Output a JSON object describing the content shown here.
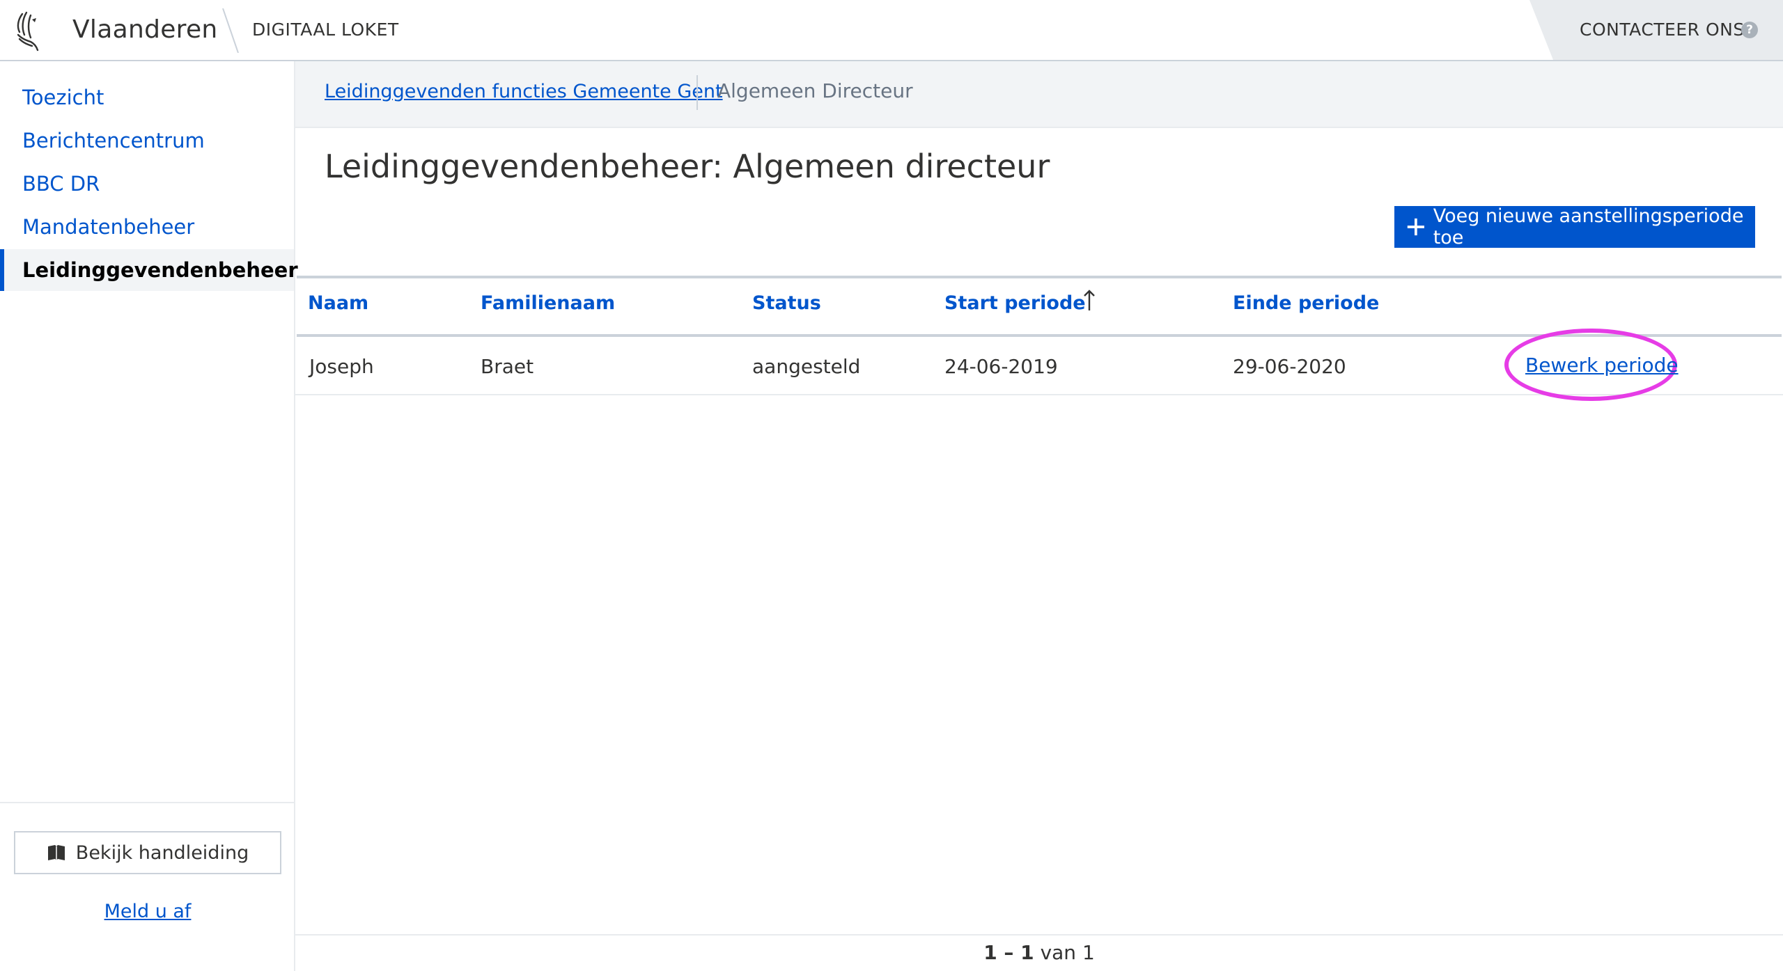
{
  "header": {
    "brand": "Vlaanderen",
    "app_name": "DIGITAAL LOKET",
    "contact_label": "CONTACTEER ONS",
    "help_glyph": "?"
  },
  "sidebar": {
    "items": [
      {
        "label": "Toezicht",
        "active": false
      },
      {
        "label": "Berichtencentrum",
        "active": false
      },
      {
        "label": "BBC DR",
        "active": false
      },
      {
        "label": "Mandatenbeheer",
        "active": false
      },
      {
        "label": "Leidinggevendenbeheer",
        "active": true
      }
    ],
    "manual_button": "Bekijk handleiding",
    "logout_link": "Meld u af"
  },
  "breadcrumb": {
    "parent": "Leidinggevenden functies Gemeente Gent",
    "current": "Algemeen Directeur"
  },
  "page": {
    "title": "Leidinggevendenbeheer: Algemeen directeur",
    "add_button": "Voeg nieuwe aanstellingsperiode toe"
  },
  "table": {
    "columns": [
      "Naam",
      "Familienaam",
      "Status",
      "Start periode",
      "Einde periode"
    ],
    "sort_column": "Start periode",
    "sort_direction": "ascending",
    "rows": [
      {
        "naam": "Joseph",
        "familienaam": "Braet",
        "status": "aangesteld",
        "start": "24-06-2019",
        "einde": "29-06-2020",
        "action": "Bewerk periode"
      }
    ]
  },
  "pagination": {
    "range": "1 – 1",
    "of_label": "van 1"
  },
  "colors": {
    "primary": "#0055cc",
    "highlight": "#e63ce6",
    "header_grey": "#e8ebee"
  }
}
